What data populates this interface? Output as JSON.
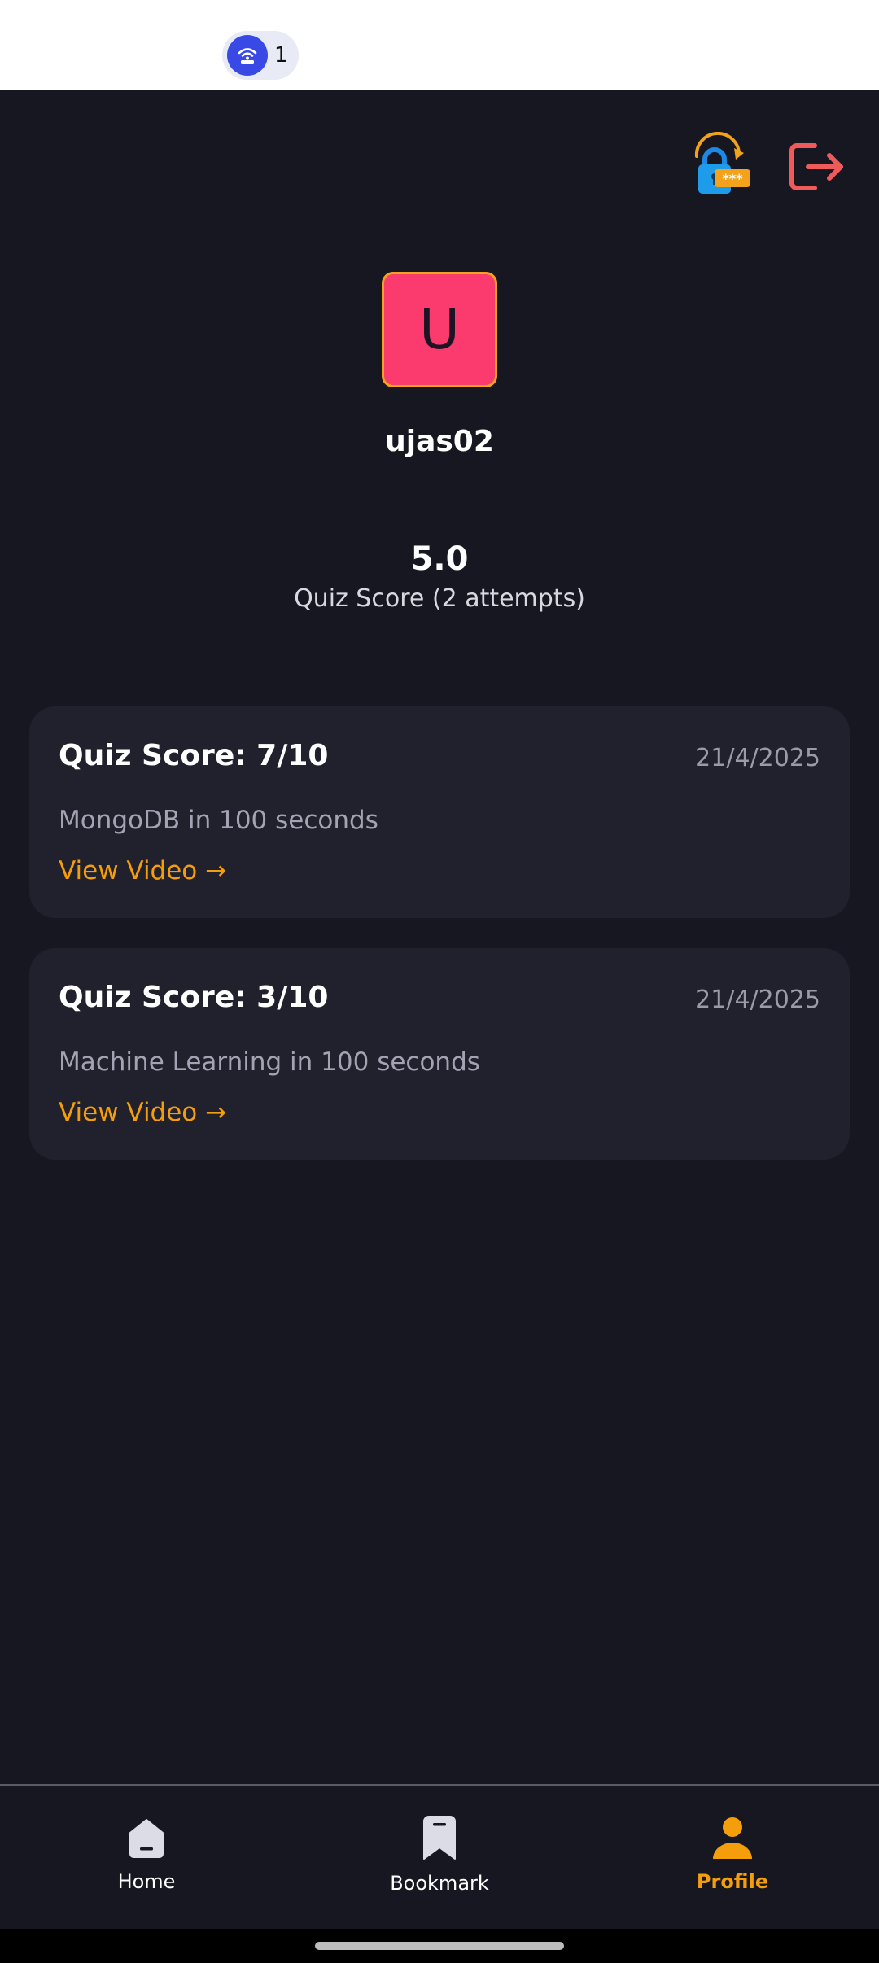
{
  "status_bar": {
    "hotspot_count": "1"
  },
  "profile": {
    "avatar_letter": "U",
    "username": "ujas02",
    "average_score": "5.0",
    "score_label": "Quiz Score (2 attempts)"
  },
  "attempts": [
    {
      "title": "Quiz Score: 7/10",
      "date": "21/4/2025",
      "subtitle": "MongoDB in 100 seconds",
      "link": "View Video →"
    },
    {
      "title": "Quiz Score: 3/10",
      "date": "21/4/2025",
      "subtitle": "Machine Learning in 100 seconds",
      "link": "View Video →"
    }
  ],
  "nav": {
    "items": [
      {
        "label": "Home",
        "icon": "home-icon",
        "active": false
      },
      {
        "label": "Bookmark",
        "icon": "bookmark-icon",
        "active": false
      },
      {
        "label": "Profile",
        "icon": "profile-icon",
        "active": true
      }
    ]
  },
  "colors": {
    "background": "#171722",
    "card": "#21212d",
    "accent": "#f59e0b",
    "avatar": "#fb3a6d",
    "logout": "#f15a5a"
  }
}
